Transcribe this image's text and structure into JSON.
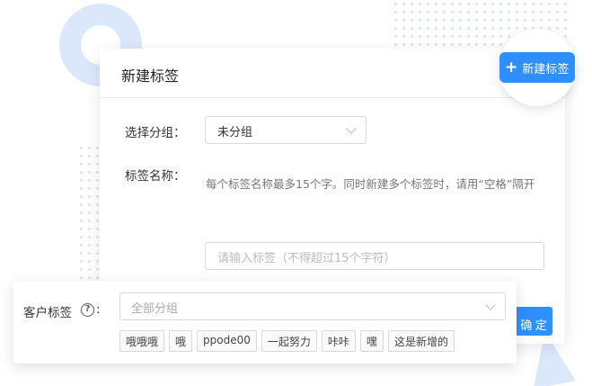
{
  "dialog": {
    "title": "新建标签",
    "group_label": "选择分组：",
    "group_value": "未分组",
    "name_label": "标签名称：",
    "hint": "每个标签名称最多15个字。同时新建多个标签时，请用“空格”隔开",
    "input_placeholder": "请输入标签（不得超过15个字符）",
    "ok_label": "确 定"
  },
  "new_tag_button": {
    "label": "新建标签",
    "icon": "plus-icon"
  },
  "customer_tags": {
    "label": "客户标签",
    "colon": ":",
    "help_glyph": "?",
    "select_placeholder": "全部分组",
    "tags": [
      "哦哦哦",
      "哦",
      "ppode00",
      "一起努力",
      "咔咔",
      "嘿",
      "这是新增的"
    ]
  },
  "colors": {
    "accent": "#2f8fff",
    "decor": "#dbe7fb"
  }
}
